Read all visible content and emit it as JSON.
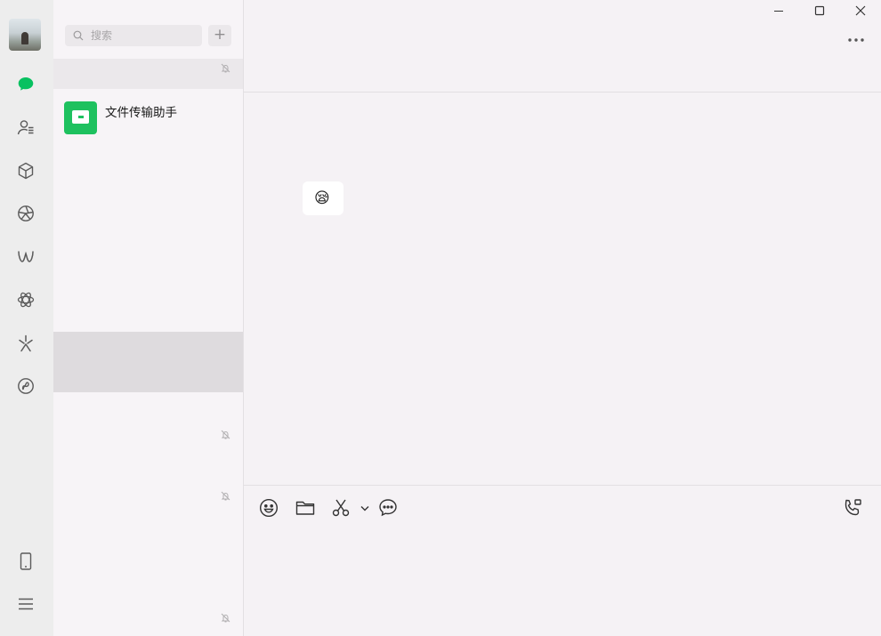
{
  "nav": {
    "icons": [
      "chat-icon",
      "contacts-icon",
      "favorites-icon",
      "moments-icon",
      "channels-icon",
      "mini-programs-icon",
      "search-discovery-icon",
      "weixin-games-icon"
    ],
    "bottom_icons": [
      "phone-icon",
      "menu-icon"
    ],
    "accent_color": "#07c160"
  },
  "search": {
    "placeholder": "搜索",
    "add_label": "+"
  },
  "chat_list": {
    "items": [
      {
        "name": "文件传输助手",
        "avatar_icon": "folder-icon"
      }
    ]
  },
  "window": {
    "minimize": "minimize-icon",
    "maximize": "maximize-icon",
    "close": "close-icon",
    "more": "more-icon"
  },
  "message": {
    "emoji": "😪"
  },
  "toolbar": {
    "icons": [
      "emoji-icon",
      "folder-icon",
      "scissors-icon",
      "chevron-down-icon",
      "chat-bubble-icon"
    ],
    "call_icon": "voice-call-icon"
  }
}
